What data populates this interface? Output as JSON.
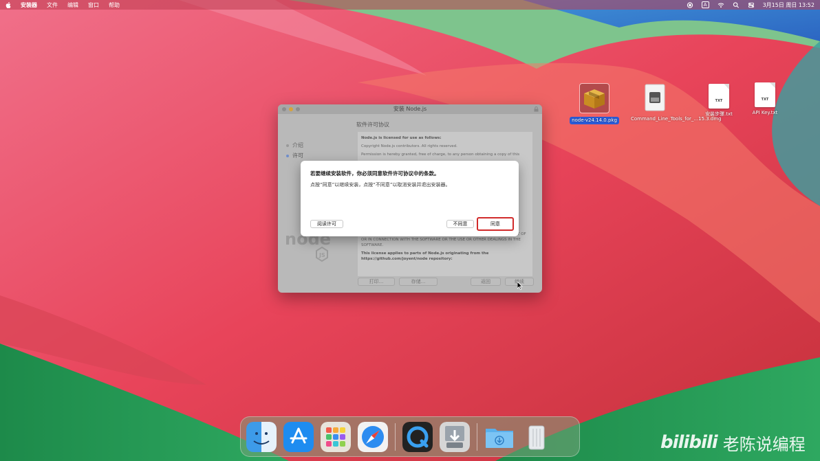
{
  "menubar": {
    "app_name": "安装器",
    "items": [
      "文件",
      "编辑",
      "窗口",
      "帮助"
    ],
    "ime": "A",
    "clock": "3月15日 周日 13:52"
  },
  "desktop": {
    "icons": [
      {
        "label": "node-v24.14.0.pkg",
        "selected": true
      },
      {
        "label": "Command_Line_Tools_for_...15.3.dmg"
      },
      {
        "label": "安装步骤.txt",
        "badge": "TXT"
      },
      {
        "label": "API Key.txt",
        "badge": "TXT"
      }
    ]
  },
  "installer": {
    "title": "安装 Node.js",
    "heading": "软件许可协议",
    "steps": [
      "介绍",
      "许可"
    ],
    "license": {
      "line1": "Node.js is licensed for use as follows:",
      "line2": "Copyright Node.js contributors. All rights reserved.",
      "line3": "Permission is hereby granted, free of charge, to any person obtaining a copy of this",
      "line4": "WHETHER IN AN ACTION OF CONTRACT, TORT OR OTHERWISE, ARISING FROM, OUT OF OR IN CONNECTION WITH THE SOFTWARE OR THE USE OR OTHER DEALINGS IN THE SOFTWARE.",
      "line5": "This license applies to parts of Node.js originating from the https://github.com/joyent/node repository:"
    },
    "buttons": {
      "print": "打印...",
      "save": "存储...",
      "back": "返回",
      "continue": "继续"
    }
  },
  "alert": {
    "title": "若要继续安装软件，你必须同意软件许可协议中的条款。",
    "message": "点按“同意”以继续安装，点按“不同意”以取消安装并退出安装器。",
    "read_license": "阅读许可",
    "disagree": "不同意",
    "agree": "同意"
  },
  "dock": {
    "apps": [
      "finder-icon",
      "app-store-icon",
      "launchpad-icon",
      "safari-icon",
      "quicktime-icon",
      "installer-icon",
      "downloads-folder-icon",
      "trash-icon"
    ]
  },
  "watermark": {
    "brand": "bilibili",
    "author": "老陈说编程"
  }
}
